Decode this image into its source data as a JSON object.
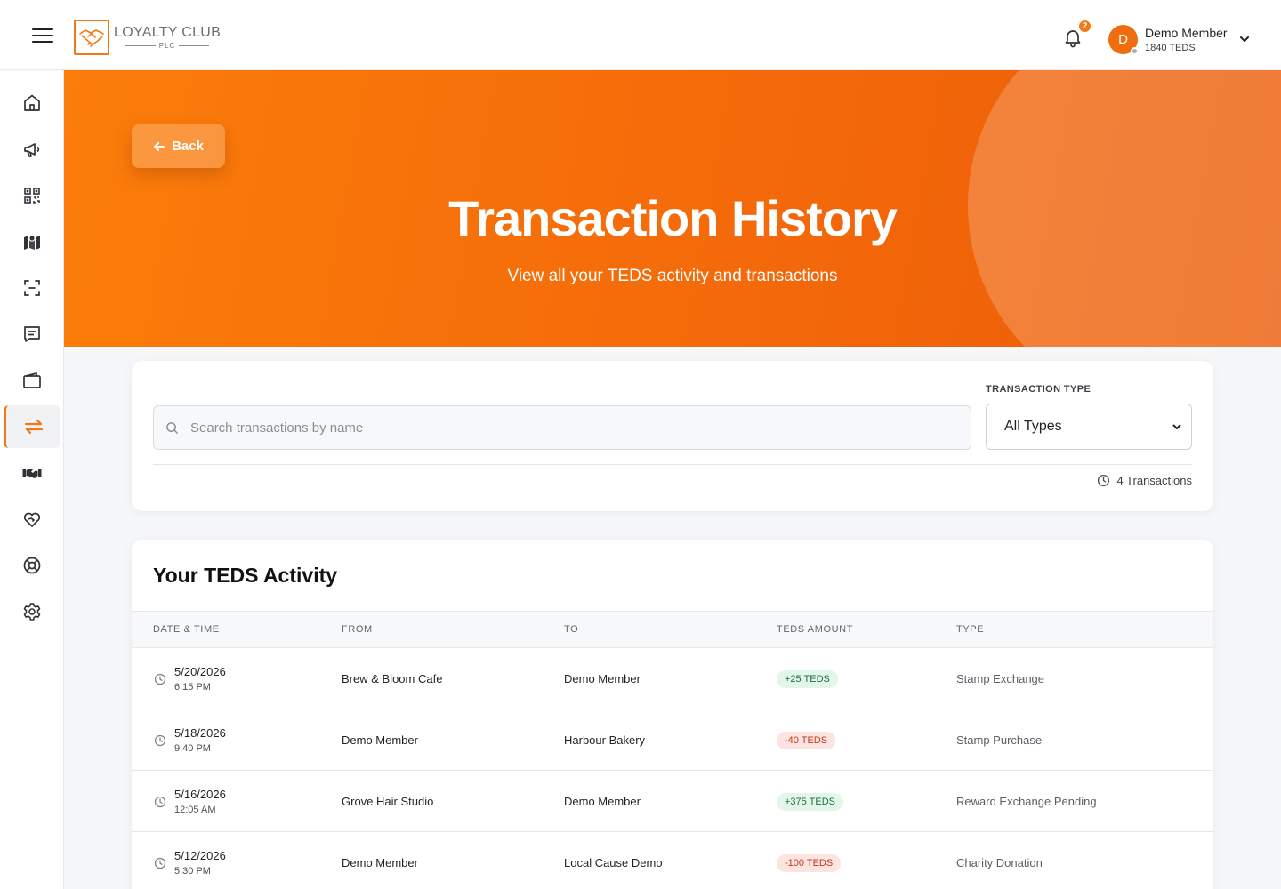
{
  "header": {
    "logo_title": "LOYALTY CLUB",
    "logo_subtitle": "PLC",
    "notification_count": "2",
    "user_initial": "D",
    "user_name": "Demo Member",
    "user_balance": "1840 TEDS"
  },
  "sidebar": {
    "items": [
      {
        "icon": "home-icon"
      },
      {
        "icon": "megaphone-icon"
      },
      {
        "icon": "qr-code-icon"
      },
      {
        "icon": "map-icon"
      },
      {
        "icon": "scan-icon"
      },
      {
        "icon": "messages-icon"
      },
      {
        "icon": "wallet-icon"
      },
      {
        "icon": "transfer-icon",
        "active": true
      },
      {
        "icon": "handshake-icon"
      },
      {
        "icon": "charity-heart-icon"
      },
      {
        "icon": "support-lifebuoy-icon"
      },
      {
        "icon": "settings-gear-icon"
      }
    ],
    "accent_color": "#f07a16"
  },
  "hero": {
    "back_label": "Back",
    "title": "Transaction History",
    "subtitle": "View all your TEDS activity and transactions"
  },
  "filters": {
    "search_placeholder": "Search transactions by name",
    "type_label": "TRANSACTION TYPE",
    "type_selected": "All Types",
    "count_text": "4 Transactions"
  },
  "activity": {
    "title": "Your TEDS Activity",
    "columns": [
      "DATE & TIME",
      "FROM",
      "TO",
      "TEDS AMOUNT",
      "TYPE"
    ],
    "rows": [
      {
        "date": "5/20/2026",
        "time": "6:15 PM",
        "from": "Brew & Bloom Cafe",
        "to": "Demo Member",
        "amount": "+25 TEDS",
        "sign": "pos",
        "type": "Stamp Exchange"
      },
      {
        "date": "5/18/2026",
        "time": "9:40 PM",
        "from": "Demo Member",
        "to": "Harbour Bakery",
        "amount": "-40 TEDS",
        "sign": "neg",
        "type": "Stamp Purchase"
      },
      {
        "date": "5/16/2026",
        "time": "12:05 AM",
        "from": "Grove Hair Studio",
        "to": "Demo Member",
        "amount": "+375 TEDS",
        "sign": "pos",
        "type": "Reward Exchange Pending"
      },
      {
        "date": "5/12/2026",
        "time": "5:30 PM",
        "from": "Demo Member",
        "to": "Local Cause Demo",
        "amount": "-100 TEDS",
        "sign": "neg",
        "type": "Charity Donation"
      }
    ]
  },
  "colors": {
    "brand_orange": "#f07a16",
    "positive_bg": "#e3f6ea",
    "negative_bg": "#fde4e0"
  }
}
